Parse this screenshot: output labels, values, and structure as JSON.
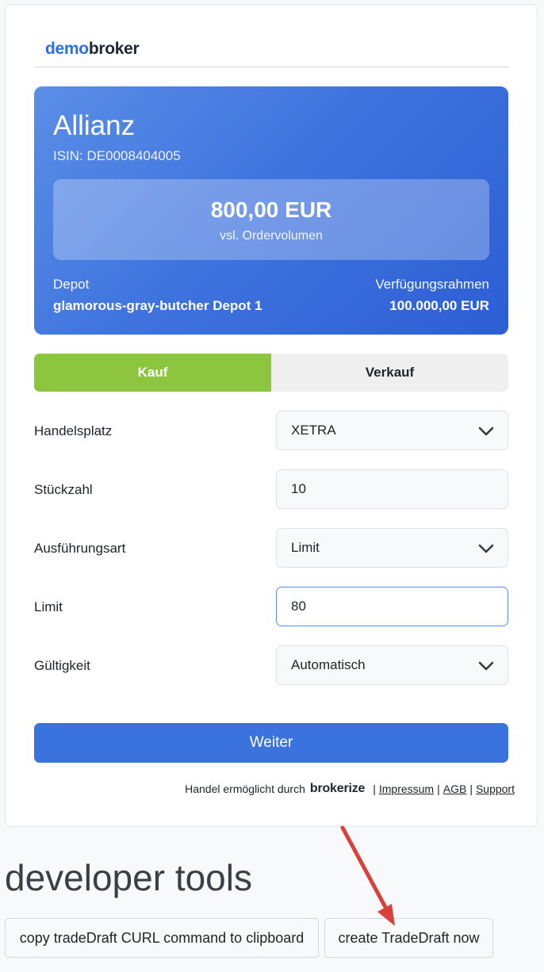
{
  "brand": {
    "logo_part1": "demo",
    "logo_part2": "broker"
  },
  "instrument": {
    "name": "Allianz",
    "isin": "ISIN: DE0008404005",
    "volume_value": "800,00 EUR",
    "volume_label": "vsl. Ordervolumen",
    "depot_label": "Depot",
    "depot_name": "glamorous-gray-butcher Depot 1",
    "limit_label": "Verfügungsrahmen",
    "limit_value": "100.000,00 EUR"
  },
  "tabs": {
    "buy": "Kauf",
    "sell": "Verkauf",
    "active": "buy"
  },
  "form": {
    "exchange_label": "Handelsplatz",
    "exchange_value": "XETRA",
    "quantity_label": "Stückzahl",
    "quantity_value": "10",
    "order_type_label": "Ausführungsart",
    "order_type_value": "Limit",
    "limit_label": "Limit",
    "limit_value": "80",
    "validity_label": "Gültigkeit",
    "validity_value": "Automatisch"
  },
  "submit_label": "Weiter",
  "footer": {
    "enabled_by": "Handel ermöglicht durch",
    "brand": "brokerize",
    "impressum": "Impressum",
    "agb": "AGB",
    "support": "Support",
    "separator": "|"
  },
  "dev_tools": {
    "title": "developer tools",
    "copy_button": "copy tradeDraft CURL command to clipboard",
    "create_button": "create TradeDraft now"
  },
  "colors": {
    "buy_active": "#8cc63f",
    "primary": "#3b73de",
    "annotation_arrow": "#d9403a"
  }
}
